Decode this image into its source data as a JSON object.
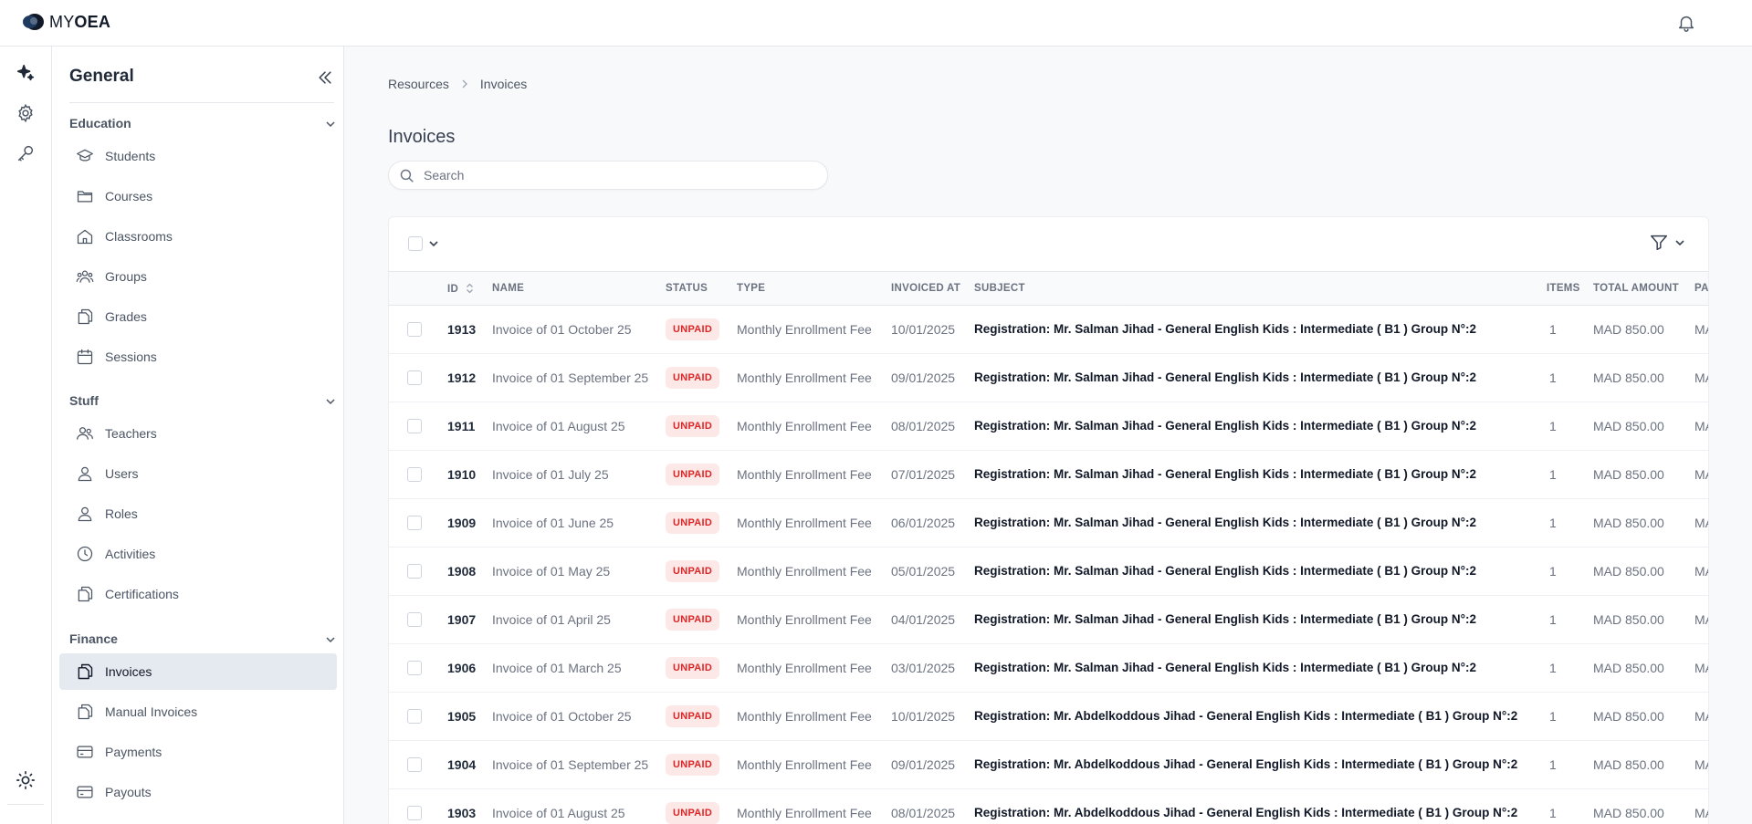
{
  "app": {
    "logo_light": "MY",
    "logo_bold": "OEA"
  },
  "rail": {
    "items": [
      "sparkles-icon",
      "gear-icon",
      "key-icon"
    ],
    "bottom": "sun-icon"
  },
  "sidebar": {
    "title": "General",
    "sections": [
      {
        "label": "Education",
        "items": [
          "Students",
          "Courses",
          "Classrooms",
          "Groups",
          "Grades",
          "Sessions"
        ]
      },
      {
        "label": "Stuff",
        "items": [
          "Teachers",
          "Users",
          "Roles",
          "Activities",
          "Certifications"
        ]
      },
      {
        "label": "Finance",
        "items": [
          "Invoices",
          "Manual Invoices",
          "Payments",
          "Payouts"
        ]
      }
    ],
    "active_item": "Invoices"
  },
  "breadcrumb": {
    "items": [
      "Resources",
      "Invoices"
    ]
  },
  "page": {
    "title": "Invoices"
  },
  "search": {
    "placeholder": "Search"
  },
  "table": {
    "columns": [
      "ID",
      "NAME",
      "STATUS",
      "TYPE",
      "INVOICED AT",
      "SUBJECT",
      "ITEMS",
      "TOTAL AMOUNT",
      "PAI"
    ],
    "rows": [
      {
        "id": "1913",
        "name": "Invoice of 01 October 25",
        "status": "UNPAID",
        "type": "Monthly Enrollment Fee",
        "invoiced_at": "10/01/2025",
        "subject": "Registration: Mr. Salman Jihad - General English Kids : Intermediate ( B1 ) Group N°:2",
        "items": "1",
        "total": "MAD 850.00",
        "paid": "MA"
      },
      {
        "id": "1912",
        "name": "Invoice of 01 September 25",
        "status": "UNPAID",
        "type": "Monthly Enrollment Fee",
        "invoiced_at": "09/01/2025",
        "subject": "Registration: Mr. Salman Jihad - General English Kids : Intermediate ( B1 ) Group N°:2",
        "items": "1",
        "total": "MAD 850.00",
        "paid": "MA"
      },
      {
        "id": "1911",
        "name": "Invoice of 01 August 25",
        "status": "UNPAID",
        "type": "Monthly Enrollment Fee",
        "invoiced_at": "08/01/2025",
        "subject": "Registration: Mr. Salman Jihad - General English Kids : Intermediate ( B1 ) Group N°:2",
        "items": "1",
        "total": "MAD 850.00",
        "paid": "MA"
      },
      {
        "id": "1910",
        "name": "Invoice of 01 July 25",
        "status": "UNPAID",
        "type": "Monthly Enrollment Fee",
        "invoiced_at": "07/01/2025",
        "subject": "Registration: Mr. Salman Jihad - General English Kids : Intermediate ( B1 ) Group N°:2",
        "items": "1",
        "total": "MAD 850.00",
        "paid": "MA"
      },
      {
        "id": "1909",
        "name": "Invoice of 01 June 25",
        "status": "UNPAID",
        "type": "Monthly Enrollment Fee",
        "invoiced_at": "06/01/2025",
        "subject": "Registration: Mr. Salman Jihad - General English Kids : Intermediate ( B1 ) Group N°:2",
        "items": "1",
        "total": "MAD 850.00",
        "paid": "MA"
      },
      {
        "id": "1908",
        "name": "Invoice of 01 May 25",
        "status": "UNPAID",
        "type": "Monthly Enrollment Fee",
        "invoiced_at": "05/01/2025",
        "subject": "Registration: Mr. Salman Jihad - General English Kids : Intermediate ( B1 ) Group N°:2",
        "items": "1",
        "total": "MAD 850.00",
        "paid": "MA"
      },
      {
        "id": "1907",
        "name": "Invoice of 01 April 25",
        "status": "UNPAID",
        "type": "Monthly Enrollment Fee",
        "invoiced_at": "04/01/2025",
        "subject": "Registration: Mr. Salman Jihad - General English Kids : Intermediate ( B1 ) Group N°:2",
        "items": "1",
        "total": "MAD 850.00",
        "paid": "MA"
      },
      {
        "id": "1906",
        "name": "Invoice of 01 March 25",
        "status": "UNPAID",
        "type": "Monthly Enrollment Fee",
        "invoiced_at": "03/01/2025",
        "subject": "Registration: Mr. Salman Jihad - General English Kids : Intermediate ( B1 ) Group N°:2",
        "items": "1",
        "total": "MAD 850.00",
        "paid": "MA"
      },
      {
        "id": "1905",
        "name": "Invoice of 01 October 25",
        "status": "UNPAID",
        "type": "Monthly Enrollment Fee",
        "invoiced_at": "10/01/2025",
        "subject": "Registration: Mr. Abdelkoddous Jihad - General English Kids : Intermediate ( B1 ) Group N°:2",
        "items": "1",
        "total": "MAD 850.00",
        "paid": "MA"
      },
      {
        "id": "1904",
        "name": "Invoice of 01 September 25",
        "status": "UNPAID",
        "type": "Monthly Enrollment Fee",
        "invoiced_at": "09/01/2025",
        "subject": "Registration: Mr. Abdelkoddous Jihad - General English Kids : Intermediate ( B1 ) Group N°:2",
        "items": "1",
        "total": "MAD 850.00",
        "paid": "MA"
      },
      {
        "id": "1903",
        "name": "Invoice of 01 August 25",
        "status": "UNPAID",
        "type": "Monthly Enrollment Fee",
        "invoiced_at": "08/01/2025",
        "subject": "Registration: Mr. Abdelkoddous Jihad - General English Kids : Intermediate ( B1 ) Group N°:2",
        "items": "1",
        "total": "MAD 850.00",
        "paid": "MA"
      }
    ]
  },
  "colors": {
    "unpaid_text": "#dc2626",
    "unpaid_bg": "#fde8e8",
    "active_nav_bg": "#e5e9f0"
  }
}
